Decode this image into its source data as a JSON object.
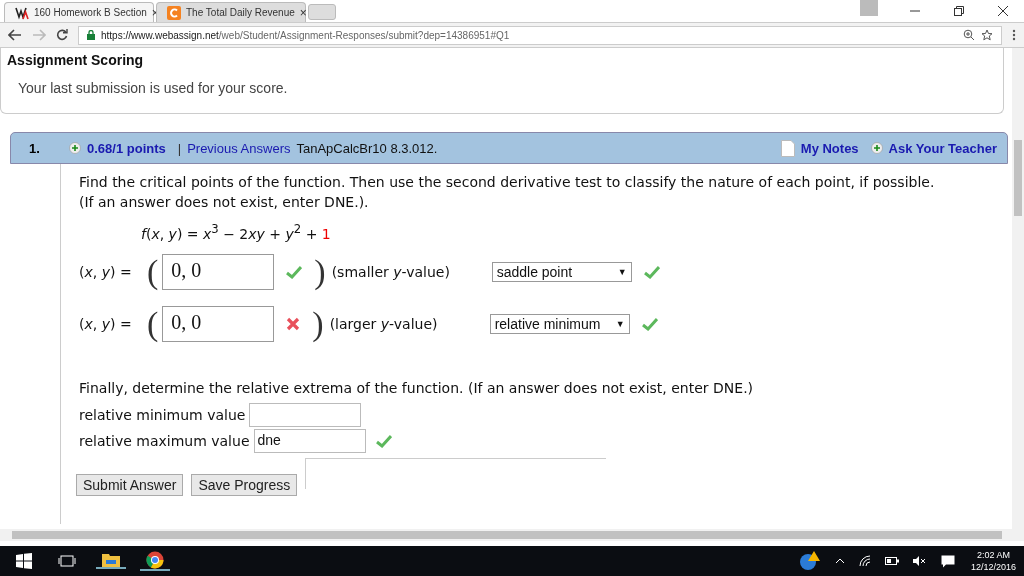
{
  "browser": {
    "tabs": [
      {
        "title": "160 Homework B Section",
        "selected": true,
        "close": "×"
      },
      {
        "title": "The Total Daily Revenue",
        "selected": false,
        "close": "×"
      }
    ],
    "url_host": "https://www.webassign.net",
    "url_path": "/web/Student/Assignment-Responses/submit?dep=14386951#Q1"
  },
  "scoring": {
    "title": "Assignment Scoring",
    "note": "Your last submission is used for your score."
  },
  "question": {
    "number": "1.",
    "points": "0.68/1 points",
    "separator": "|",
    "previous_answers": "Previous Answers",
    "code": "TanApCalcBr10 8.3.012.",
    "my_notes": "My Notes",
    "ask_teacher": "Ask Your Teacher",
    "prompt": [
      "Find the critical points of the function. Then use the second derivative test to classify the nature of each point, if possible.",
      "(If an answer does not exist, enter DNE.)."
    ],
    "function": [
      "*f*(*x*, *y*) = *x*$^{3}$ − 2",
      "*xy* + *y*$^{2}$ + "
    ],
    "function_constant": "1",
    "points_rows": [
      {
        "label": "(*x*, *y*) =",
        "open": "(",
        "value": "0, 0",
        "correct": true,
        "close": ")",
        "hint": "(smaller *y*-value)",
        "choice": "saddle point",
        "arrow": "▼",
        "choice_correct": true
      },
      {
        "label": "(*x*, *y*) =",
        "open": "(",
        "value": "0, 0",
        "correct": false,
        "close": ")",
        "hint": "(larger *y*-value)",
        "choice": "relative minimum",
        "arrow": "▼",
        "choice_correct": true
      }
    ],
    "extrema_prompt": "Finally, determine the relative extrema of the function. (If an answer does not exist, enter DNE.)",
    "extrema": [
      {
        "label": "relative minimum value",
        "checked": false
      },
      {
        "label": "relative maximum value",
        "value": "dne",
        "checked": true
      }
    ],
    "buttons": [
      "Submit Answer",
      "Save Progress"
    ]
  },
  "taskbar": {
    "time": "2:02 AM",
    "date": "12/12/2016"
  }
}
